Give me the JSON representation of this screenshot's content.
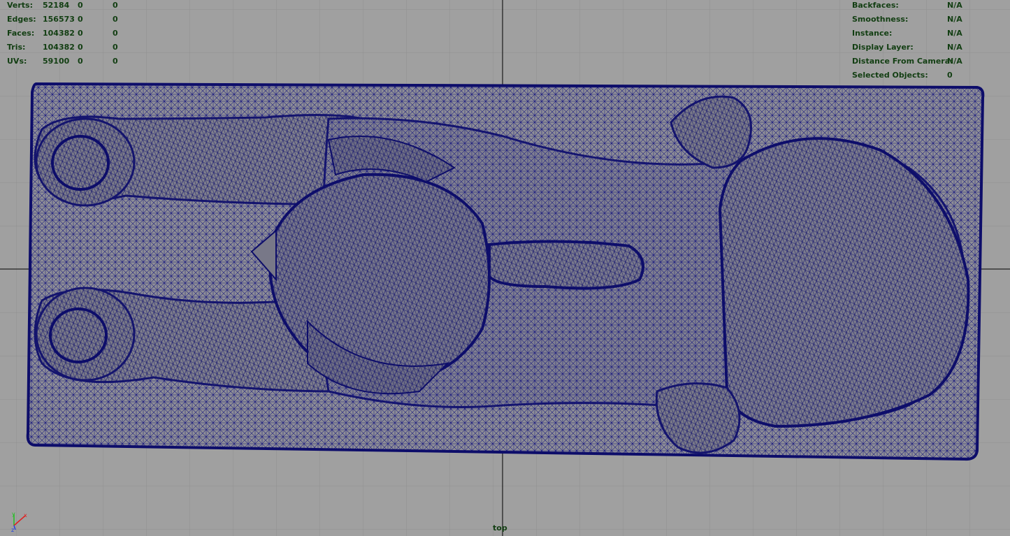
{
  "stats": [
    {
      "label": "Verts:",
      "v1": "52184",
      "v2": "0",
      "v3": "0"
    },
    {
      "label": "Edges:",
      "v1": "156573",
      "v2": "0",
      "v3": "0"
    },
    {
      "label": "Faces:",
      "v1": "104382",
      "v2": "0",
      "v3": "0"
    },
    {
      "label": "Tris:",
      "v1": "104382",
      "v2": "0",
      "v3": "0"
    },
    {
      "label": "UVs:",
      "v1": "59100",
      "v2": "0",
      "v3": "0"
    }
  ],
  "info": [
    {
      "label": "Backfaces:",
      "value": "N/A"
    },
    {
      "label": "Smoothness:",
      "value": "N/A"
    },
    {
      "label": "Instance:",
      "value": "N/A"
    },
    {
      "label": "Display Layer:",
      "value": "N/A"
    },
    {
      "label": "Distance From Camera:",
      "value": "N/A"
    },
    {
      "label": "Selected Objects:",
      "value": "0"
    }
  ],
  "camera_label": "top",
  "axis": {
    "y": "y",
    "x": "x",
    "z": "z"
  },
  "colors": {
    "background": "#a0a0a0",
    "grid": "#8f8f8f",
    "axis_line": "#000000",
    "wire": "#1a1a80",
    "hud_text": "#123e12",
    "axis_x": "#e02020",
    "axis_y": "#20c020",
    "axis_z": "#2040e0"
  }
}
